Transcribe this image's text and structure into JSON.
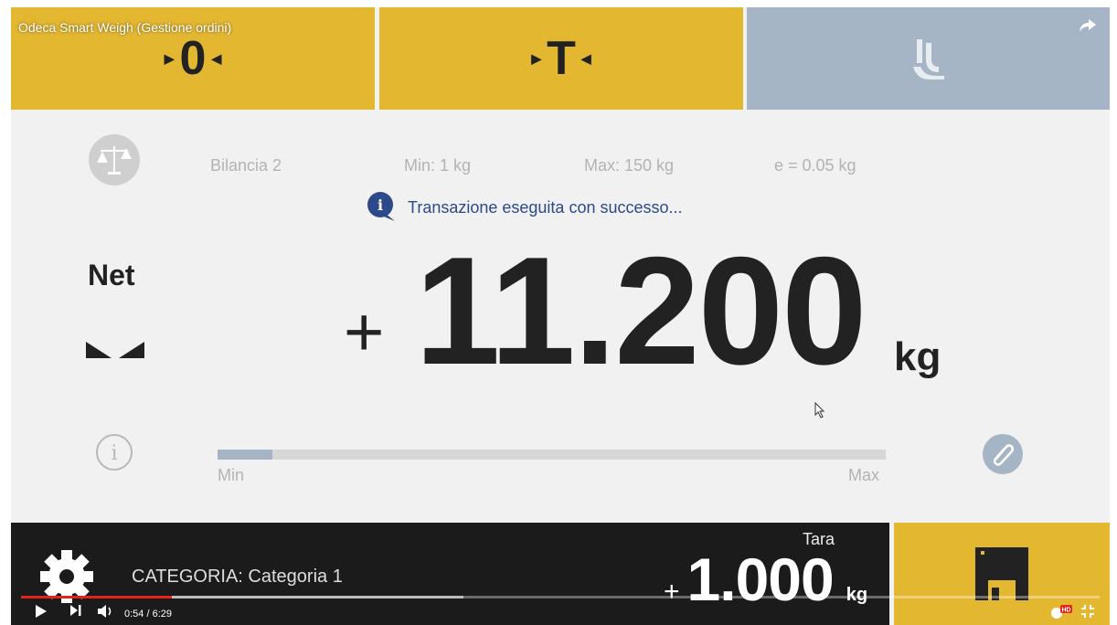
{
  "video": {
    "title": "Odeca Smart Weigh (Gestione ordini)",
    "time": "0:54 / 6:29",
    "progress_fraction": 0.14,
    "buffer_fraction": 0.41,
    "hd_badge": "HD"
  },
  "topbar": {
    "zero_label": "0",
    "tare_label": "T",
    "logo_icon": "brand-logo-icon"
  },
  "scale": {
    "name": "Bilancia 2",
    "min": "Min: 1 kg",
    "max": "Max: 150 kg",
    "division": "e = 0.05 kg"
  },
  "message": {
    "text": "Transazione eseguita con successo...",
    "icon_letter": "i"
  },
  "weight": {
    "mode": "Net",
    "sign": "+",
    "value": "11.200",
    "unit": "kg"
  },
  "range": {
    "min_label": "Min",
    "max_label": "Max",
    "fill_fraction": 0.082
  },
  "bottom": {
    "category": "CATEGORIA: Categoria 1",
    "tare_label": "Tara",
    "tare_sign": "+",
    "tare_value": "1.000",
    "tare_unit": "kg"
  },
  "colors": {
    "accent_yellow": "#e4b731",
    "slate_blue": "#a6b5c5",
    "dark": "#1b1b1b",
    "message_blue": "#2c4a8a"
  }
}
